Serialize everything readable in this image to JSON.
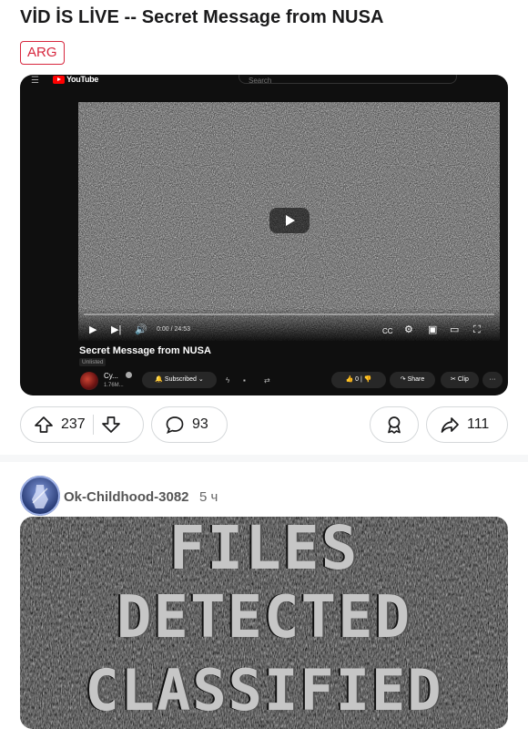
{
  "post": {
    "title": "VİD İS LİVE -- Secret Message from NUSA",
    "flair": "ARG"
  },
  "video": {
    "site_logo": "YouTube",
    "search_placeholder": "Search",
    "time": "0:00 / 24:53",
    "title": "Secret Message from NUSA",
    "visibility": "Unlisted",
    "channel_name": "Cy...",
    "channel_subs": "1.76M...",
    "subscribe_label": "Subscribed",
    "like_count": "0",
    "share_label": "Share",
    "clip_label": "Clip",
    "more_label": "···"
  },
  "actions": {
    "upvote_count": "237",
    "comment_count": "93",
    "share_count": "111"
  },
  "comment": {
    "username": "Ok-Childhood-3082",
    "age": "5 ч",
    "image_text": [
      "FILES",
      "DETECTED",
      "CLASSIFIED"
    ]
  },
  "colors": {
    "flair": "#d7263d",
    "border": "#d5d8da",
    "video_bg": "#0f0f0f"
  }
}
